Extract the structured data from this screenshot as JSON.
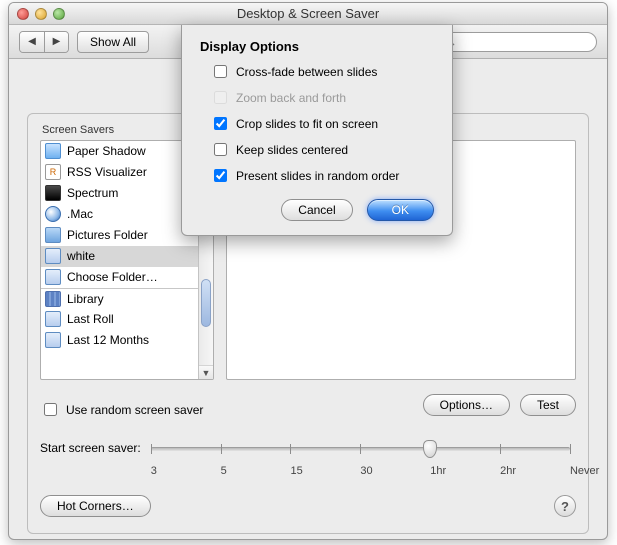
{
  "window": {
    "title": "Desktop & Screen Saver",
    "show_all_label": "Show All"
  },
  "search": {
    "placeholder": ""
  },
  "group": {
    "header": "Screen Savers",
    "use_random_label": "Use random screen saver",
    "use_random_checked": false,
    "options_button": "Options…",
    "test_button": "Test",
    "hot_corners_button": "Hot Corners…"
  },
  "savers": {
    "items": [
      {
        "label": "Paper Shadow",
        "icon": "paper"
      },
      {
        "label": "RSS Visualizer",
        "icon": "rss"
      },
      {
        "label": "Spectrum",
        "icon": "spectrum"
      },
      {
        "label": ".Mac",
        "icon": "mac"
      },
      {
        "label": "Pictures Folder",
        "icon": "folder"
      },
      {
        "label": "white",
        "icon": "sp-folder"
      },
      {
        "label": "Choose Folder…",
        "icon": "sp-folder"
      },
      {
        "label": "Library",
        "icon": "library"
      },
      {
        "label": "Last Roll",
        "icon": "sp-folder"
      },
      {
        "label": "Last 12 Months",
        "icon": "sp-folder"
      }
    ],
    "selected_index": 5,
    "separator_before_index": 7
  },
  "slider": {
    "label": "Start screen saver:",
    "ticks": [
      "3",
      "5",
      "15",
      "30",
      "1hr",
      "2hr",
      "Never"
    ],
    "value_index": 4
  },
  "sheet": {
    "title": "Display Options",
    "options": [
      {
        "label": "Cross-fade between slides",
        "checked": false,
        "disabled": false
      },
      {
        "label": "Zoom back and forth",
        "checked": false,
        "disabled": true
      },
      {
        "label": "Crop slides to fit on screen",
        "checked": true,
        "disabled": false
      },
      {
        "label": "Keep slides centered",
        "checked": false,
        "disabled": false
      },
      {
        "label": "Present slides in random order",
        "checked": true,
        "disabled": false
      }
    ],
    "cancel_label": "Cancel",
    "ok_label": "OK"
  }
}
